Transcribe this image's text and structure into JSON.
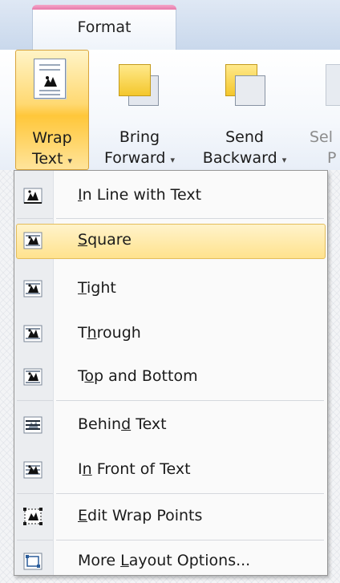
{
  "ribbon": {
    "tab_label": "Format",
    "wrap_text": {
      "line1": "Wrap",
      "line2": "Text"
    },
    "bring_forward": {
      "line1": "Bring",
      "line2": "Forward"
    },
    "send_backward": {
      "line1": "Send",
      "line2": "Backward"
    },
    "selection_partial": {
      "line1": "Sel",
      "line2": "P"
    },
    "dropdown_arrow": "▾"
  },
  "menu": {
    "items": [
      {
        "pre": "",
        "key": "I",
        "post": "n Line with Text"
      },
      {
        "pre": "",
        "key": "S",
        "post": "quare"
      },
      {
        "pre": "",
        "key": "T",
        "post": "ight"
      },
      {
        "pre": "T",
        "key": "h",
        "post": "rough"
      },
      {
        "pre": "T",
        "key": "o",
        "post": "p and Bottom"
      },
      {
        "pre": "Behin",
        "key": "d",
        "post": " Text"
      },
      {
        "pre": "I",
        "key": "n",
        "post": " Front of Text"
      },
      {
        "pre": "",
        "key": "E",
        "post": "dit Wrap Points"
      },
      {
        "pre": "More ",
        "key": "L",
        "post": "ayout Options..."
      }
    ],
    "highlighted_index": 1
  },
  "colors": {
    "accent_tab": "#e77aab",
    "highlight_fill": "#ffe28d",
    "highlight_border": "#e4bd5b"
  }
}
